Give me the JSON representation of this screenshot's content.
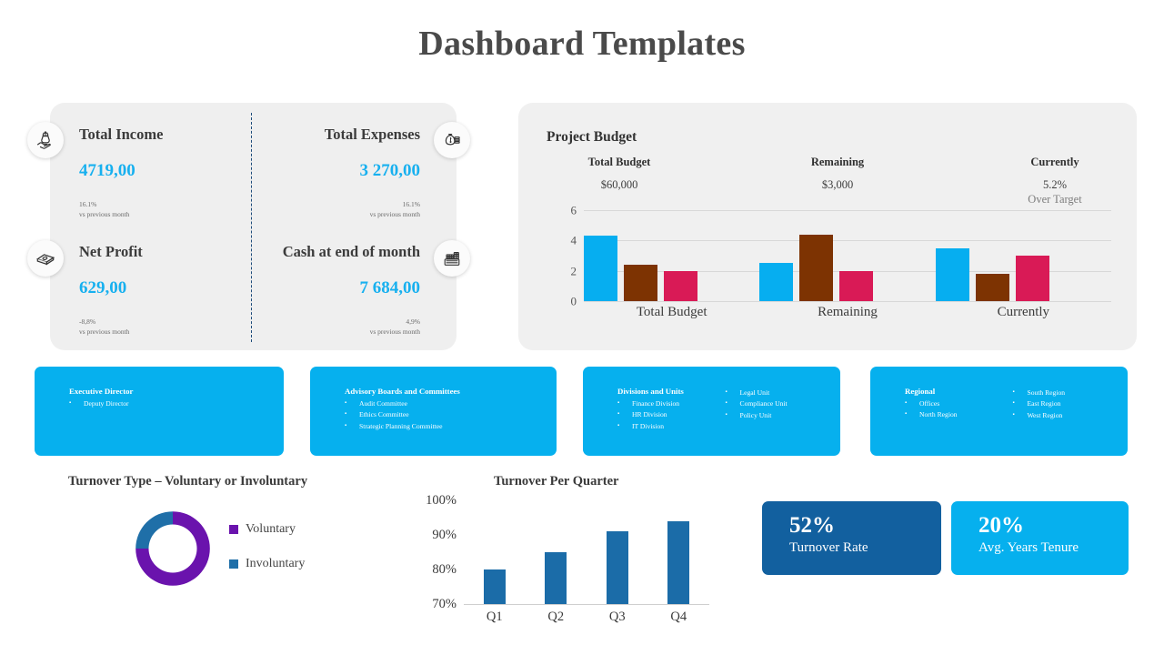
{
  "page": {
    "title": "Dashboard Templates"
  },
  "colors": {
    "accent_cyan": "#06b0ee",
    "value_blue": "#17b0ef",
    "bar_cyan": "#06aef0",
    "bar_brown": "#7d3302",
    "bar_crimson": "#d91a56",
    "donut_purple": "#6a13ad",
    "donut_blue": "#1f6fa8",
    "tile_dark_blue": "#12609f",
    "panel_grey": "#efefef"
  },
  "kpi_panel": {
    "cells": [
      {
        "label": "Total Income",
        "value": "4719,00",
        "delta": "16.1%",
        "delta_note": "vs previous  month",
        "icon": "hand-money-icon"
      },
      {
        "label": "Total Expenses",
        "value": "3 270,00",
        "delta": "16.1%",
        "delta_note": "vs previous  month",
        "icon": "money-bag-coins-icon"
      },
      {
        "label": "Net Profit",
        "value": "629,00",
        "delta": "-8,8%",
        "delta_note": "vs previous  month",
        "icon": "cash-stack-icon"
      },
      {
        "label": "Cash at end of month",
        "value": "7 684,00",
        "delta": "4,9%",
        "delta_note": "vs previous  month",
        "icon": "cash-register-icon"
      }
    ]
  },
  "budget": {
    "title": "Project Budget",
    "columns": [
      {
        "head": "Total  Budget",
        "value": "$60,000",
        "sub": ""
      },
      {
        "head": "Remaining",
        "value": "$3,000",
        "sub": ""
      },
      {
        "head": "Currently",
        "value": "5.2%",
        "sub": "Over Target"
      }
    ]
  },
  "org_cards": [
    {
      "name": "executive-director",
      "columns": [
        {
          "title": "Executive Director",
          "items": [
            "Deputy Director"
          ]
        }
      ]
    },
    {
      "name": "advisory-boards",
      "columns": [
        {
          "title": "Advisory  Boards and Committees",
          "items": [
            "Audit Committee",
            "Ethics Committee",
            "Strategic  Planning Committee"
          ]
        }
      ]
    },
    {
      "name": "divisions-and-units",
      "columns": [
        {
          "title": "Divisions and Units",
          "items": [
            "Finance Division",
            "HR Division",
            "IT Division"
          ]
        },
        {
          "title": "",
          "items": [
            "Legal Unit",
            "Compliance Unit",
            "Policy Unit"
          ]
        }
      ]
    },
    {
      "name": "regional",
      "columns": [
        {
          "title": "Regional",
          "items": [
            "Offices",
            "North Region"
          ]
        },
        {
          "title": "",
          "items": [
            "South Region",
            "East Region",
            "West Region"
          ]
        }
      ]
    }
  ],
  "donut": {
    "title": "Turnover Type – Voluntary or Involuntary"
  },
  "quarter": {
    "title": "Turnover Per Quarter"
  },
  "tiles": [
    {
      "value": "52%",
      "label": "Turnover Rate"
    },
    {
      "value": "20%",
      "label": "Avg. Years Tenure"
    }
  ],
  "chart_data": [
    {
      "type": "bar",
      "name": "project-budget-chart",
      "title": "Project Budget",
      "categories": [
        "Total Budget",
        "Remaining",
        "Currently"
      ],
      "series": [
        {
          "name": "series-1",
          "color": "#06aef0",
          "values": [
            4.3,
            2.5,
            3.5
          ]
        },
        {
          "name": "series-2",
          "color": "#7d3302",
          "values": [
            2.4,
            4.4,
            1.8
          ]
        },
        {
          "name": "series-3",
          "color": "#d91a56",
          "values": [
            2.0,
            2.0,
            3.0
          ]
        }
      ],
      "ylabel": "",
      "xlabel": "",
      "ylim": [
        0,
        6
      ],
      "yticks": [
        0,
        2,
        4,
        6
      ],
      "ytick_labels": [
        "0",
        "2",
        "4",
        "6"
      ],
      "grid": true,
      "legend": "none"
    },
    {
      "type": "pie",
      "name": "turnover-type-donut",
      "title": "Turnover Type – Voluntary or Involuntary",
      "categories": [
        "Voluntary",
        "Involuntary"
      ],
      "values": [
        75,
        25
      ],
      "colors": [
        "#6a13ad",
        "#1f6fa8"
      ],
      "donut": true,
      "legend": "right"
    },
    {
      "type": "bar",
      "name": "turnover-per-quarter-chart",
      "title": "Turnover Per Quarter",
      "categories": [
        "Q1",
        "Q2",
        "Q3",
        "Q4"
      ],
      "values": [
        80,
        85,
        91,
        94
      ],
      "color": "#1b6ca8",
      "ylabel": "",
      "xlabel": "",
      "ylim": [
        70,
        100
      ],
      "yticks": [
        70,
        80,
        90,
        100
      ],
      "ytick_labels": [
        "70%",
        "80%",
        "90%",
        "100%"
      ],
      "grid": false,
      "legend": "none"
    }
  ]
}
